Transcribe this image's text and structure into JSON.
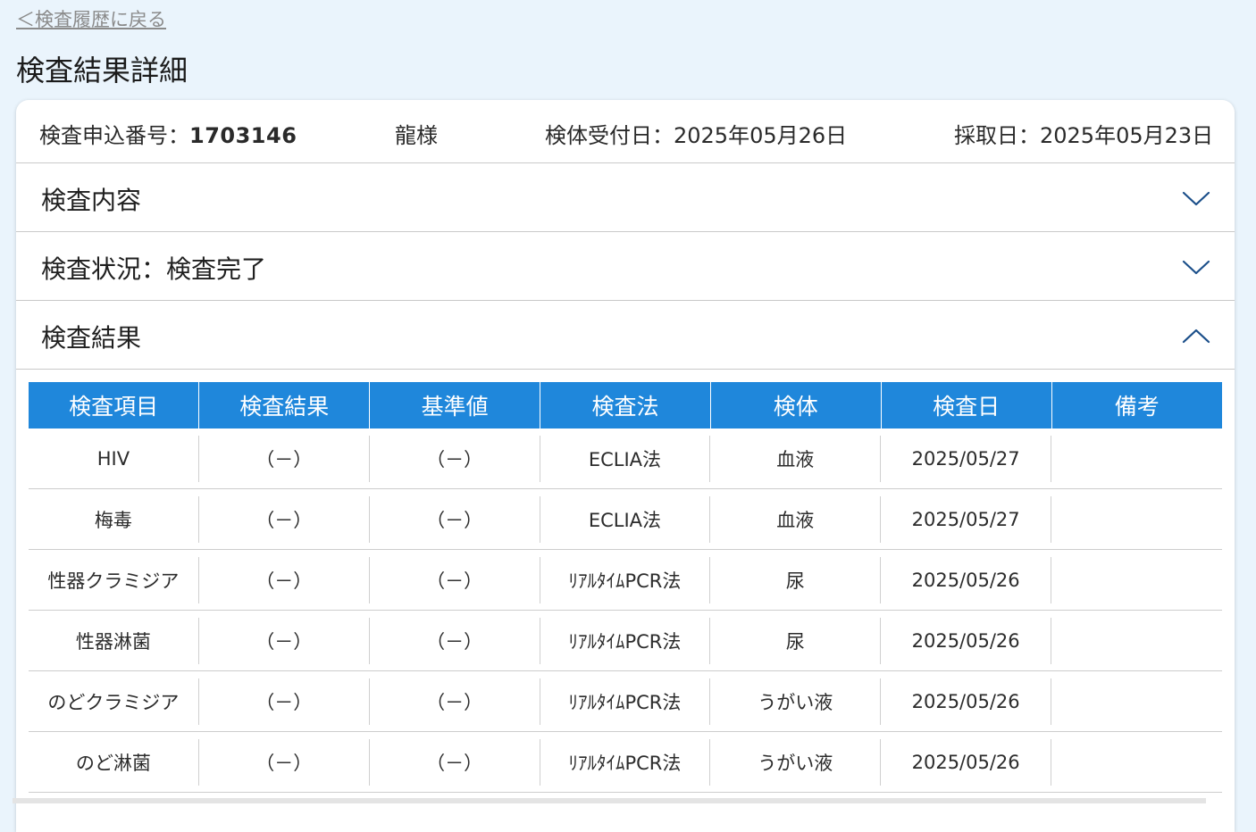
{
  "nav": {
    "back_label": "＜検査履歴に戻る"
  },
  "page": {
    "title": "検査結果詳細"
  },
  "summary": {
    "application_label": "検査申込番号：",
    "application_number": "1703146",
    "patient_name": "龍様",
    "received_label": "検体受付日：",
    "received_date": "2025年05月26日",
    "collected_label": "採取日：",
    "collected_date": "2025年05月23日"
  },
  "sections": {
    "contents": {
      "label": "検査内容",
      "icon": "chevron-down-icon"
    },
    "status": {
      "label": "検査状況：検査完了",
      "icon": "chevron-down-icon"
    },
    "results": {
      "label": "検査結果",
      "icon": "chevron-up-icon"
    }
  },
  "colors": {
    "page_background": "#eaf4fc",
    "header_blue": "#1f87db",
    "chevron_blue": "#1b4f8a"
  },
  "table": {
    "headers": [
      "検査項目",
      "検査結果",
      "基準値",
      "検査法",
      "検体",
      "検査日",
      "備考"
    ],
    "rows": [
      [
        "HIV",
        "（－）",
        "（－）",
        "ECLIA法",
        "血液",
        "2025/05/27",
        ""
      ],
      [
        "梅毒",
        "（－）",
        "（－）",
        "ECLIA法",
        "血液",
        "2025/05/27",
        ""
      ],
      [
        "性器クラミジア",
        "（－）",
        "（－）",
        "ﾘｱﾙﾀｲﾑPCR法",
        "尿",
        "2025/05/26",
        ""
      ],
      [
        "性器淋菌",
        "（－）",
        "（－）",
        "ﾘｱﾙﾀｲﾑPCR法",
        "尿",
        "2025/05/26",
        ""
      ],
      [
        "のどクラミジア",
        "（－）",
        "（－）",
        "ﾘｱﾙﾀｲﾑPCR法",
        "うがい液",
        "2025/05/26",
        ""
      ],
      [
        "のど淋菌",
        "（－）",
        "（－）",
        "ﾘｱﾙﾀｲﾑPCR法",
        "うがい液",
        "2025/05/26",
        ""
      ]
    ]
  }
}
